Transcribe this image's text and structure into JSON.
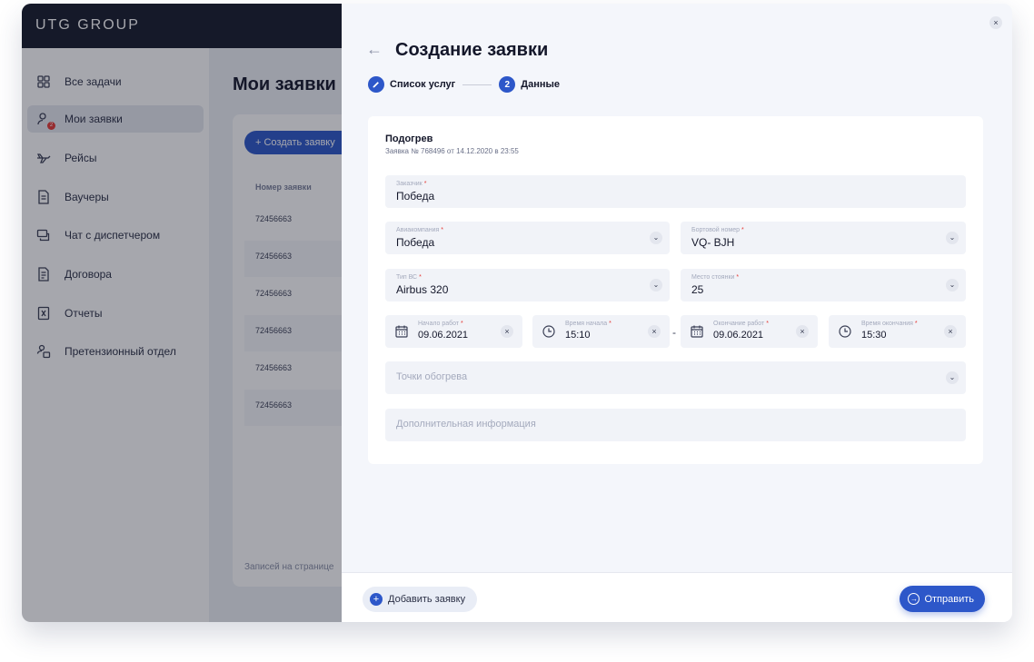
{
  "app": {
    "logo": "UTG GROUP",
    "page_title": "Мои заявки",
    "create_button": "+ Создать заявку",
    "column_header": "Номер заявки",
    "rows": [
      "72456663",
      "72456663",
      "72456663",
      "72456663",
      "72456663",
      "72456663"
    ],
    "per_page": "Записей на странице"
  },
  "sidebar": {
    "items": [
      {
        "label": "Все задачи",
        "icon": "grid-icon"
      },
      {
        "label": "Мои заявки",
        "icon": "user-requests-icon",
        "badge": "2",
        "active": true
      },
      {
        "label": "Рейсы",
        "icon": "plane-icon"
      },
      {
        "label": "Ваучеры",
        "icon": "document-icon"
      },
      {
        "label": "Чат с диспетчером",
        "icon": "chat-icon"
      },
      {
        "label": "Договора",
        "icon": "contract-icon"
      },
      {
        "label": "Отчеты",
        "icon": "report-icon"
      },
      {
        "label": "Претензионный отдел",
        "icon": "claims-icon"
      }
    ]
  },
  "modal": {
    "title": "Создание заявки",
    "steps": [
      {
        "label": "Список услуг",
        "state": "done"
      },
      {
        "label": "Данные",
        "number": "2",
        "state": "active"
      }
    ],
    "service": {
      "name": "Подогрев",
      "subtitle": "Заявка № 768496 от 14.12.2020 в 23:55"
    },
    "fields": {
      "customer": {
        "label": "Заказчик",
        "value": "Победа"
      },
      "airline": {
        "label": "Авиакомпания",
        "value": "Победа"
      },
      "board_number": {
        "label": "Бортовой номер",
        "value": "VQ- BJH"
      },
      "aircraft_type": {
        "label": "Тип ВС",
        "value": "Airbus 320"
      },
      "parking": {
        "label": "Место стоянки",
        "value": "25"
      },
      "work_start": {
        "label": "Начало работ",
        "value": "09.06.2021"
      },
      "start_time": {
        "label": "Время начала",
        "value": "15:10"
      },
      "work_end": {
        "label": "Окончание работ",
        "value": "09.06.2021"
      },
      "end_time": {
        "label": "Время окончания",
        "value": "15:30"
      },
      "heating_points": {
        "placeholder": "Точки обогрева"
      },
      "additional_info": {
        "placeholder": "Дополнительная информация"
      }
    },
    "required_mark": "*",
    "range_separator": "-",
    "add_button": "Добавить заявку",
    "send_button": "Отправить",
    "close": "×",
    "back": "←",
    "chevron": "⌄",
    "clear": "×"
  },
  "colors": {
    "accent": "#2d57c9",
    "topbar": "#161b2b",
    "required": "#e53935"
  }
}
